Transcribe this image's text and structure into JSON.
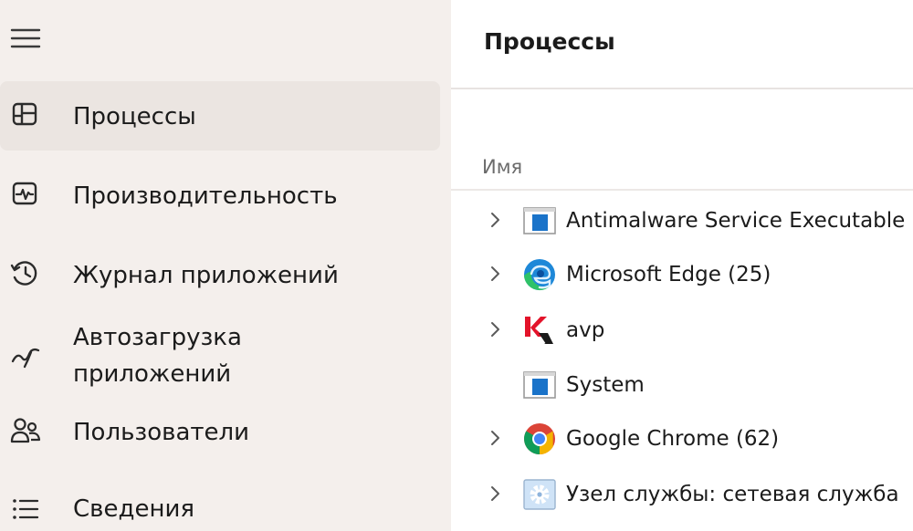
{
  "sidebar": {
    "menu_icon": "hamburger-menu-icon",
    "items": [
      {
        "label": "Процессы",
        "icon": "processes-icon",
        "selected": true
      },
      {
        "label": "Производительность",
        "icon": "performance-icon",
        "selected": false
      },
      {
        "label": "Журнал приложений",
        "icon": "app-history-icon",
        "selected": false
      },
      {
        "label": "Автозагрузка приложений",
        "icon": "startup-apps-icon",
        "selected": false
      },
      {
        "label": "Пользователи",
        "icon": "users-icon",
        "selected": false
      },
      {
        "label": "Сведения",
        "icon": "details-icon",
        "selected": false
      }
    ]
  },
  "main": {
    "title": "Процессы",
    "column_header": "Имя",
    "processes": [
      {
        "name": "Antimalware Service Executable",
        "icon": "windows-app-icon",
        "expandable": true
      },
      {
        "name": "Microsoft Edge (25)",
        "icon": "edge-icon",
        "expandable": true
      },
      {
        "name": "avp",
        "icon": "kaspersky-icon",
        "expandable": true
      },
      {
        "name": "System",
        "icon": "windows-app-icon",
        "expandable": false
      },
      {
        "name": "Google Chrome (62)",
        "icon": "chrome-icon",
        "expandable": true
      },
      {
        "name": "Узел службы: сетевая служба",
        "icon": "service-host-gear-icon",
        "expandable": true
      }
    ]
  },
  "colors": {
    "sidebar_bg": "#f4efec",
    "selected_bg": "#ebe5e1",
    "main_bg": "#ffffff",
    "text": "#1b1b1b",
    "muted_text": "#6b6b6b",
    "windows_blue": "#1a73c9",
    "kaspersky_red": "#e3132a"
  }
}
